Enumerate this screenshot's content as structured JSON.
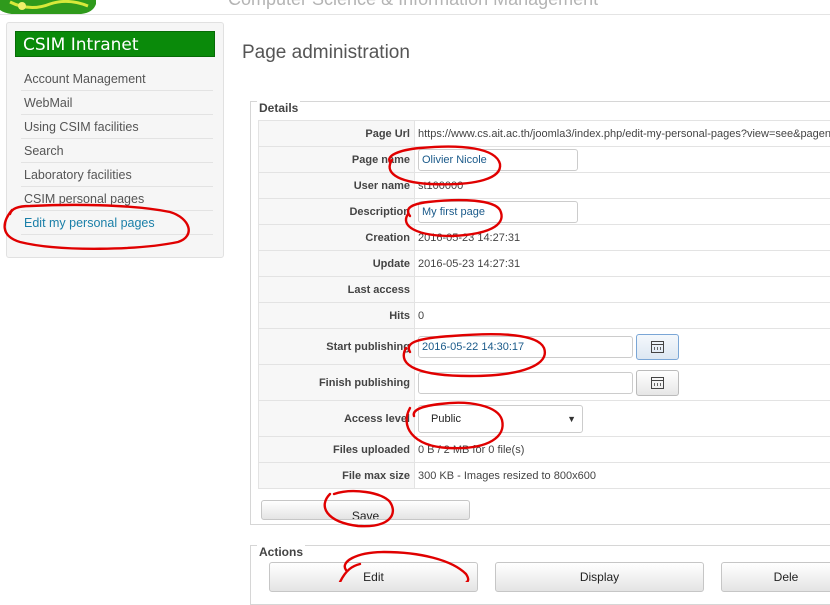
{
  "header": {
    "site_title": "Computer Science & Information Management"
  },
  "sidebar": {
    "title": "CSIM Intranet",
    "items": [
      {
        "label": "Account Management"
      },
      {
        "label": "WebMail"
      },
      {
        "label": "Using CSIM facilities"
      },
      {
        "label": "Search"
      },
      {
        "label": "Laboratory facilities"
      },
      {
        "label": "CSIM personal pages"
      },
      {
        "label": "Edit my personal pages"
      }
    ]
  },
  "main": {
    "title": "Page administration",
    "details_legend": "Details",
    "fields": {
      "page_url": {
        "label": "Page Url",
        "value": "https://www.cs.ait.ac.th/joomla3/index.php/edit-my-personal-pages?view=see&pagen"
      },
      "page_name": {
        "label": "Page name",
        "value": "Olivier Nicole"
      },
      "user_name": {
        "label": "User name",
        "value": "st100000"
      },
      "description": {
        "label": "Description",
        "value": "My first page"
      },
      "creation": {
        "label": "Creation",
        "value": "2016-05-23 14:27:31"
      },
      "update": {
        "label": "Update",
        "value": "2016-05-23 14:27:31"
      },
      "last_access": {
        "label": "Last access",
        "value": ""
      },
      "hits": {
        "label": "Hits",
        "value": "0"
      },
      "start_publishing": {
        "label": "Start publishing",
        "value": "2016-05-22 14:30:17"
      },
      "finish_publishing": {
        "label": "Finish publishing",
        "value": ""
      },
      "access_level": {
        "label": "Access level",
        "value": "Public"
      },
      "files_uploaded": {
        "label": "Files uploaded",
        "value": "0 B / 2 MB for 0 file(s)"
      },
      "file_max_size": {
        "label": "File max size",
        "value": "300 KB - Images resized to 800x600"
      }
    },
    "save_label": "Save",
    "actions_legend": "Actions",
    "actions": {
      "edit": "Edit",
      "display": "Display",
      "delete": "Dele"
    }
  },
  "icons": {
    "calendar": "calendar-icon",
    "dropdown": "chevron-down-icon"
  },
  "colors": {
    "brand_green": "#0a8a0a",
    "link_blue": "#1a7fa8",
    "annotation_red": "#e00000"
  }
}
